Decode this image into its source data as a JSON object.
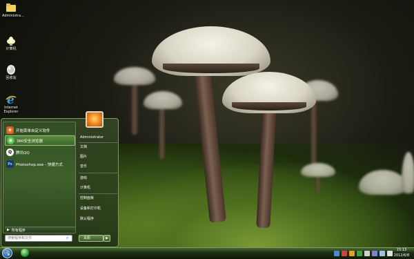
{
  "desktop": {
    "icons": [
      {
        "label": "Administra...",
        "icon": "user-folder-icon"
      },
      {
        "label": "计算机",
        "icon": "computer-icon"
      },
      {
        "label": "回收站",
        "icon": "recycle-bin-icon"
      },
      {
        "label": "Internet Explorer",
        "icon": "ie-icon"
      }
    ]
  },
  "start_menu": {
    "programs": [
      {
        "label": "开始菜单自定义软件",
        "icon": "orange-app-icon"
      },
      {
        "label": "360安全浏览器",
        "icon": "browser-360-icon"
      },
      {
        "label": "腾讯QQ",
        "icon": "qq-icon"
      },
      {
        "label": "Photoshop.exe - 快捷方式",
        "icon": "photoshop-icon"
      }
    ],
    "all_programs": "所有程序",
    "search_placeholder": "搜索程序和文件",
    "user": "Administrator",
    "links": [
      "文档",
      "图片",
      "音乐",
      "游戏",
      "计算机",
      "控制面板",
      "设备和打印机",
      "默认程序"
    ],
    "shutdown": "关机"
  },
  "taskbar": {
    "time": "15:13",
    "date": "2012/6/8"
  },
  "colors": {
    "accent": "#3c6a28",
    "taskbar": "#1e3014"
  }
}
